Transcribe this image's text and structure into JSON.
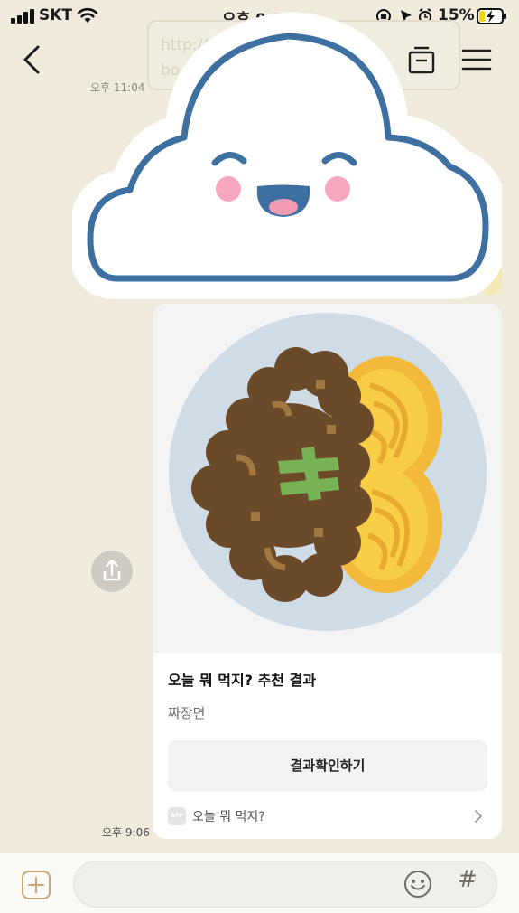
{
  "status_bar": {
    "carrier": "SKT",
    "time": "오후 9:06",
    "battery_percent": "15%",
    "icons": [
      "signal-bars-icon",
      "wifi-icon",
      "screen-lock-rotation-icon",
      "location-arrow-icon",
      "alarm-icon",
      "battery-charging-icon"
    ]
  },
  "header": {
    "icons": [
      "chevron-left-icon",
      "drawer-icon",
      "hamburger-menu-icon"
    ]
  },
  "background_chat": {
    "link_text_lines": [
      "http://... /KOR/",
      "bo... .jsp?...sjg"
    ],
    "time_1": "오후 11:04",
    "time_2": "오후"
  },
  "sticker": {
    "name": "smiling cloud",
    "colors": {
      "outline": "#3e6fa1",
      "cheek": "#f7a8be",
      "tongue": "#f39ab3",
      "mouth": "#3e6fa1"
    }
  },
  "share": {
    "icon": "share-icon"
  },
  "card": {
    "image_icon": "jjajangmyeon-plate-icon",
    "title": "오늘 뭐 먹지? 추천 결과",
    "subtitle": "짜장면",
    "action_label": "결과확인하기",
    "footer_badge": "APP",
    "footer_label": "오늘 뭐 먹지?"
  },
  "message_time": "오후 9:06",
  "input_bar": {
    "placeholder": "",
    "icons": [
      "plus-square-icon",
      "emoji-icon",
      "hash-icon"
    ],
    "hash_symbol": "#"
  },
  "colors": {
    "chat_background": "#f0ebdd",
    "card_background": "#ffffff",
    "plate": "#cfdbe5",
    "noodles": "#f6c83a",
    "sauce": "#6b4a2a",
    "garnish": "#77b255"
  }
}
